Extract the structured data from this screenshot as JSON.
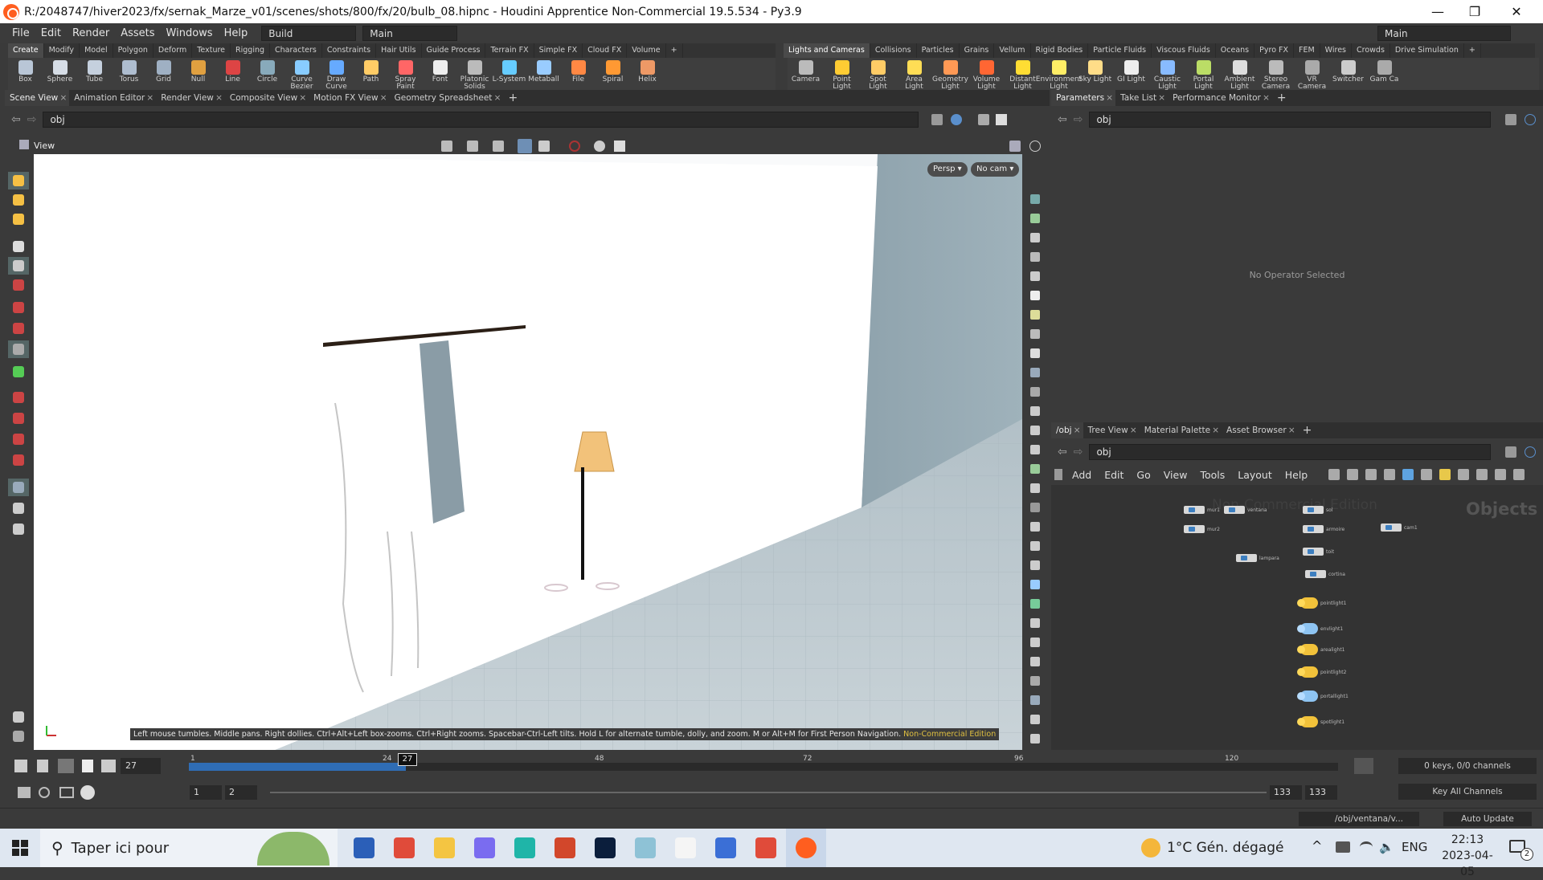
{
  "window": {
    "title": "R:/2048747/hiver2023/fx/sernak_Marze_v01/scenes/shots/800/fx/20/bulb_08.hipnc - Houdini Apprentice Non-Commercial 19.5.534 - Py3.9",
    "minimize": "—",
    "maximize": "❐",
    "close": "✕"
  },
  "menu": {
    "items": [
      "File",
      "Edit",
      "Render",
      "Assets",
      "Windows",
      "Help"
    ],
    "desktop": "Build",
    "context": "Main",
    "right_desktop": "Main"
  },
  "shelf_left": {
    "tabs": [
      "Create",
      "Modify",
      "Model",
      "Polygon",
      "Deform",
      "Texture",
      "Rigging",
      "Characters",
      "Constraints",
      "Hair Utils",
      "Guide Process",
      "Terrain FX",
      "Simple FX",
      "Cloud FX",
      "Volume"
    ],
    "tools": [
      {
        "label": "Box",
        "color": "#b9c6d6"
      },
      {
        "label": "Sphere",
        "color": "#d6dde6"
      },
      {
        "label": "Tube",
        "color": "#c5d0de"
      },
      {
        "label": "Torus",
        "color": "#aebdcf"
      },
      {
        "label": "Grid",
        "color": "#9fb0c3"
      },
      {
        "label": "Null",
        "color": "#e0a040"
      },
      {
        "label": "Line",
        "color": "#d44"
      },
      {
        "label": "Circle",
        "color": "#8ab"
      },
      {
        "label": "Curve Bezier",
        "color": "#8cf"
      },
      {
        "label": "Draw Curve",
        "color": "#6af"
      },
      {
        "label": "Path",
        "color": "#fc6"
      },
      {
        "label": "Spray Paint",
        "color": "#f66"
      },
      {
        "label": "Font",
        "color": "#eee"
      },
      {
        "label": "Platonic Solids",
        "color": "#bbb"
      },
      {
        "label": "L-System",
        "color": "#6cf"
      },
      {
        "label": "Metaball",
        "color": "#9cf"
      },
      {
        "label": "File",
        "color": "#f84"
      },
      {
        "label": "Spiral",
        "color": "#f93"
      },
      {
        "label": "Helix",
        "color": "#e96"
      }
    ]
  },
  "shelf_right": {
    "tabs": [
      "Lights and Cameras",
      "Collisions",
      "Particles",
      "Grains",
      "Vellum",
      "Rigid Bodies",
      "Particle Fluids",
      "Viscous Fluids",
      "Oceans",
      "Pyro FX",
      "FEM",
      "Wires",
      "Crowds",
      "Drive Simulation"
    ],
    "tools": [
      {
        "label": "Camera",
        "color": "#bbb"
      },
      {
        "label": "Point Light",
        "color": "#fc3"
      },
      {
        "label": "Spot Light",
        "color": "#fc6"
      },
      {
        "label": "Area Light",
        "color": "#fd5"
      },
      {
        "label": "Geometry Light",
        "color": "#f95"
      },
      {
        "label": "Volume Light",
        "color": "#f63"
      },
      {
        "label": "Distant Light",
        "color": "#fd3"
      },
      {
        "label": "Environment Light",
        "color": "#fe6"
      },
      {
        "label": "Sky Light",
        "color": "#fd8"
      },
      {
        "label": "GI Light",
        "color": "#eee"
      },
      {
        "label": "Caustic Light",
        "color": "#8bf"
      },
      {
        "label": "Portal Light",
        "color": "#bd6"
      },
      {
        "label": "Ambient Light",
        "color": "#ddd"
      },
      {
        "label": "Stereo Camera",
        "color": "#bbb"
      },
      {
        "label": "VR Camera",
        "color": "#aaa"
      },
      {
        "label": "Switcher",
        "color": "#ccc"
      },
      {
        "label": "Gam Ca",
        "color": "#aaa"
      }
    ]
  },
  "left_pane": {
    "tabs": [
      "Scene View",
      "Animation Editor",
      "Render View",
      "Composite View",
      "Motion FX View",
      "Geometry Spreadsheet"
    ],
    "path": "obj",
    "view_label": "View",
    "persp": "Persp ▾",
    "cam": "No cam ▾",
    "hint": "Left mouse tumbles. Middle pans. Right dollies. Ctrl+Alt+Left box-zooms. Ctrl+Right zooms. Spacebar-Ctrl-Left tilts. Hold L for alternate tumble, dolly, and zoom.     M or Alt+M for First Person Navigation.",
    "watermark": "Non-Commercial Edition"
  },
  "params_pane": {
    "tabs": [
      "Parameters",
      "Take List",
      "Performance Monitor"
    ],
    "path": "obj",
    "empty_text": "No Operator Selected"
  },
  "network_pane": {
    "tabs": [
      "/obj",
      "Tree View",
      "Material Palette",
      "Asset Browser"
    ],
    "path": "obj",
    "menu": [
      "Add",
      "Edit",
      "Go",
      "View",
      "Tools",
      "Layout",
      "Help"
    ],
    "watermark": "Non-Commercial Edition",
    "context_label": "Objects",
    "nodes": [
      "mur1",
      "ventana",
      "sol",
      "mur2",
      "lampara",
      "armoire",
      "toit",
      "cortina",
      "cam1"
    ],
    "lights": [
      "pointlight1",
      "envlight1",
      "arealight1",
      "pointlight2",
      "portallight1",
      "spotlight1"
    ]
  },
  "timeline": {
    "current_frame": "27",
    "ticks": [
      "1",
      "24",
      "48",
      "72",
      "96",
      "120"
    ],
    "range_start": "1",
    "range_start2": "2",
    "range_end": "133",
    "range_end2": "133",
    "keys_info": "0 keys, 0/0 channels",
    "key_all": "Key All Channels",
    "status_path": "/obj/ventana/v...",
    "auto_update": "Auto Update"
  },
  "taskbar": {
    "search": "Taper ici pour",
    "weather": "1°C  Gén. dégagé",
    "lang": "ENG",
    "time": "22:13",
    "date": "2023-04-05",
    "notif": "2",
    "apps": [
      {
        "name": "word-icon",
        "color": "#2b5fb8"
      },
      {
        "name": "chrome-icon",
        "color": "#e04b3a"
      },
      {
        "name": "explorer-icon",
        "color": "#f4c542"
      },
      {
        "name": "copilot-icon",
        "color": "#7a6cf0"
      },
      {
        "name": "maya-icon",
        "color": "#1fb5a8"
      },
      {
        "name": "powerpoint-icon",
        "color": "#d2472b"
      },
      {
        "name": "photoshop-icon",
        "color": "#0b1e3c"
      },
      {
        "name": "note-icon",
        "color": "#8ec2d6"
      },
      {
        "name": "file-icon",
        "color": "#f5f5f5"
      },
      {
        "name": "teams-icon",
        "color": "#3b6fd6"
      },
      {
        "name": "chrome2-icon",
        "color": "#e04b3a"
      },
      {
        "name": "houdini-icon",
        "color": "#ff5e1f"
      }
    ]
  }
}
